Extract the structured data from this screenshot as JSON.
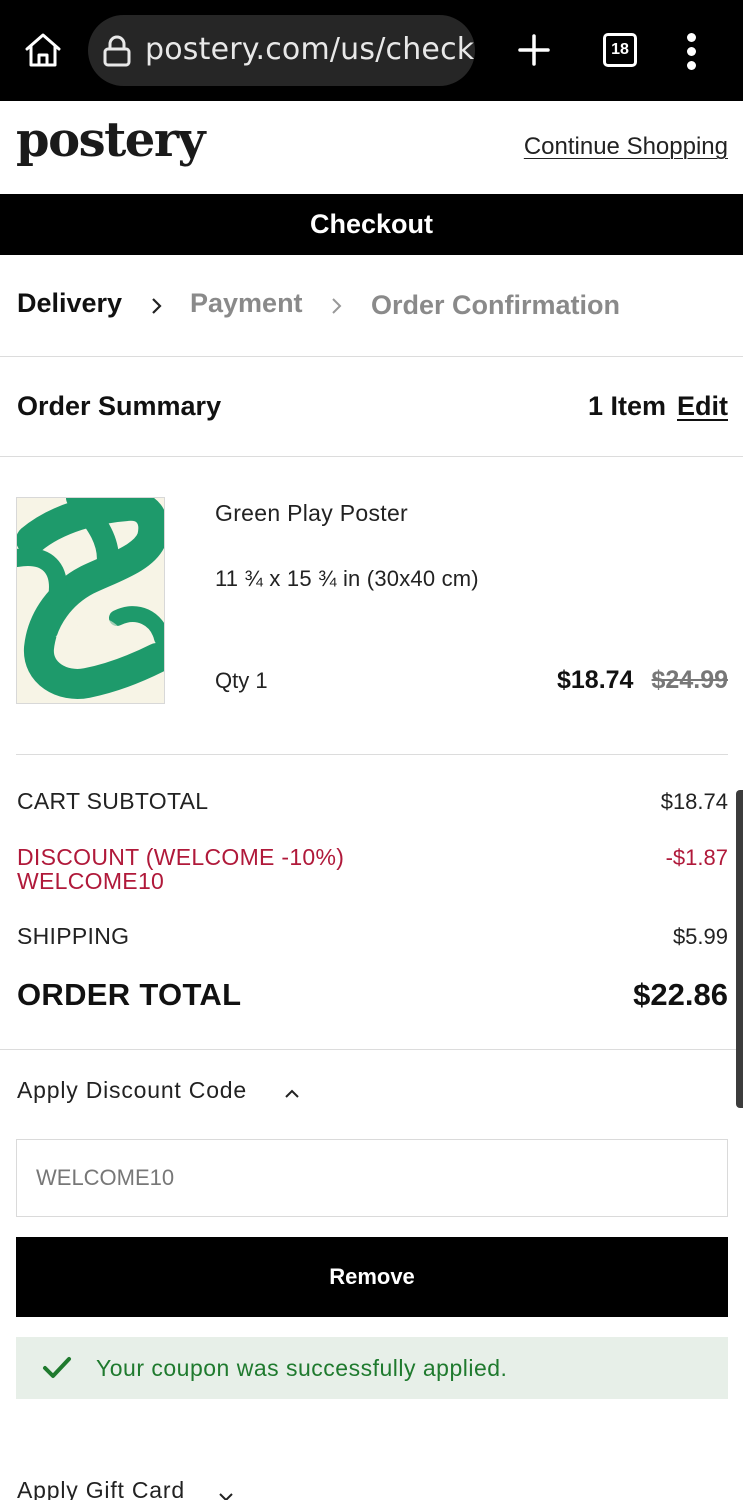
{
  "browser": {
    "url": "postery.com/us/check",
    "tab_count": "18"
  },
  "header": {
    "logo": "postery",
    "continue_link": "Continue Shopping"
  },
  "banner": {
    "title": "Checkout"
  },
  "steps": [
    {
      "label": "Delivery",
      "state": "active"
    },
    {
      "label": "Payment",
      "state": "inactive"
    },
    {
      "label": "Order Confirmation",
      "state": "inactive"
    }
  ],
  "summary": {
    "title": "Order Summary",
    "item_count": "1 Item",
    "edit_label": "Edit"
  },
  "product": {
    "name": "Green Play Poster",
    "size": "11 ¾ x 15 ¾ in (30x40 cm)",
    "qty": "Qty 1",
    "price": "$18.74",
    "original_price": "$24.99",
    "thumbnail_colors": {
      "paper": "#f7f4e6",
      "paint": "#1e9a6b"
    }
  },
  "totals": {
    "subtotal_label": "CART SUBTOTAL",
    "subtotal_value": "$18.74",
    "discount_label": "DISCOUNT (WELCOME -10%)",
    "discount_code": "WELCOME10",
    "discount_value": "-$1.87",
    "shipping_label": "SHIPPING",
    "shipping_value": "$5.99",
    "total_label": "ORDER TOTAL",
    "total_value": "$22.86"
  },
  "discount_section": {
    "toggle_label": "Apply Discount Code",
    "input_value": "WELCOME10",
    "remove_label": "Remove",
    "success_message": "Your coupon was successfully applied."
  },
  "gift_card": {
    "toggle_label": "Apply Gift Card"
  },
  "colors": {
    "discount_red": "#b0193a",
    "success_green": "#1f7a2e",
    "success_bg": "#e7efe8"
  }
}
